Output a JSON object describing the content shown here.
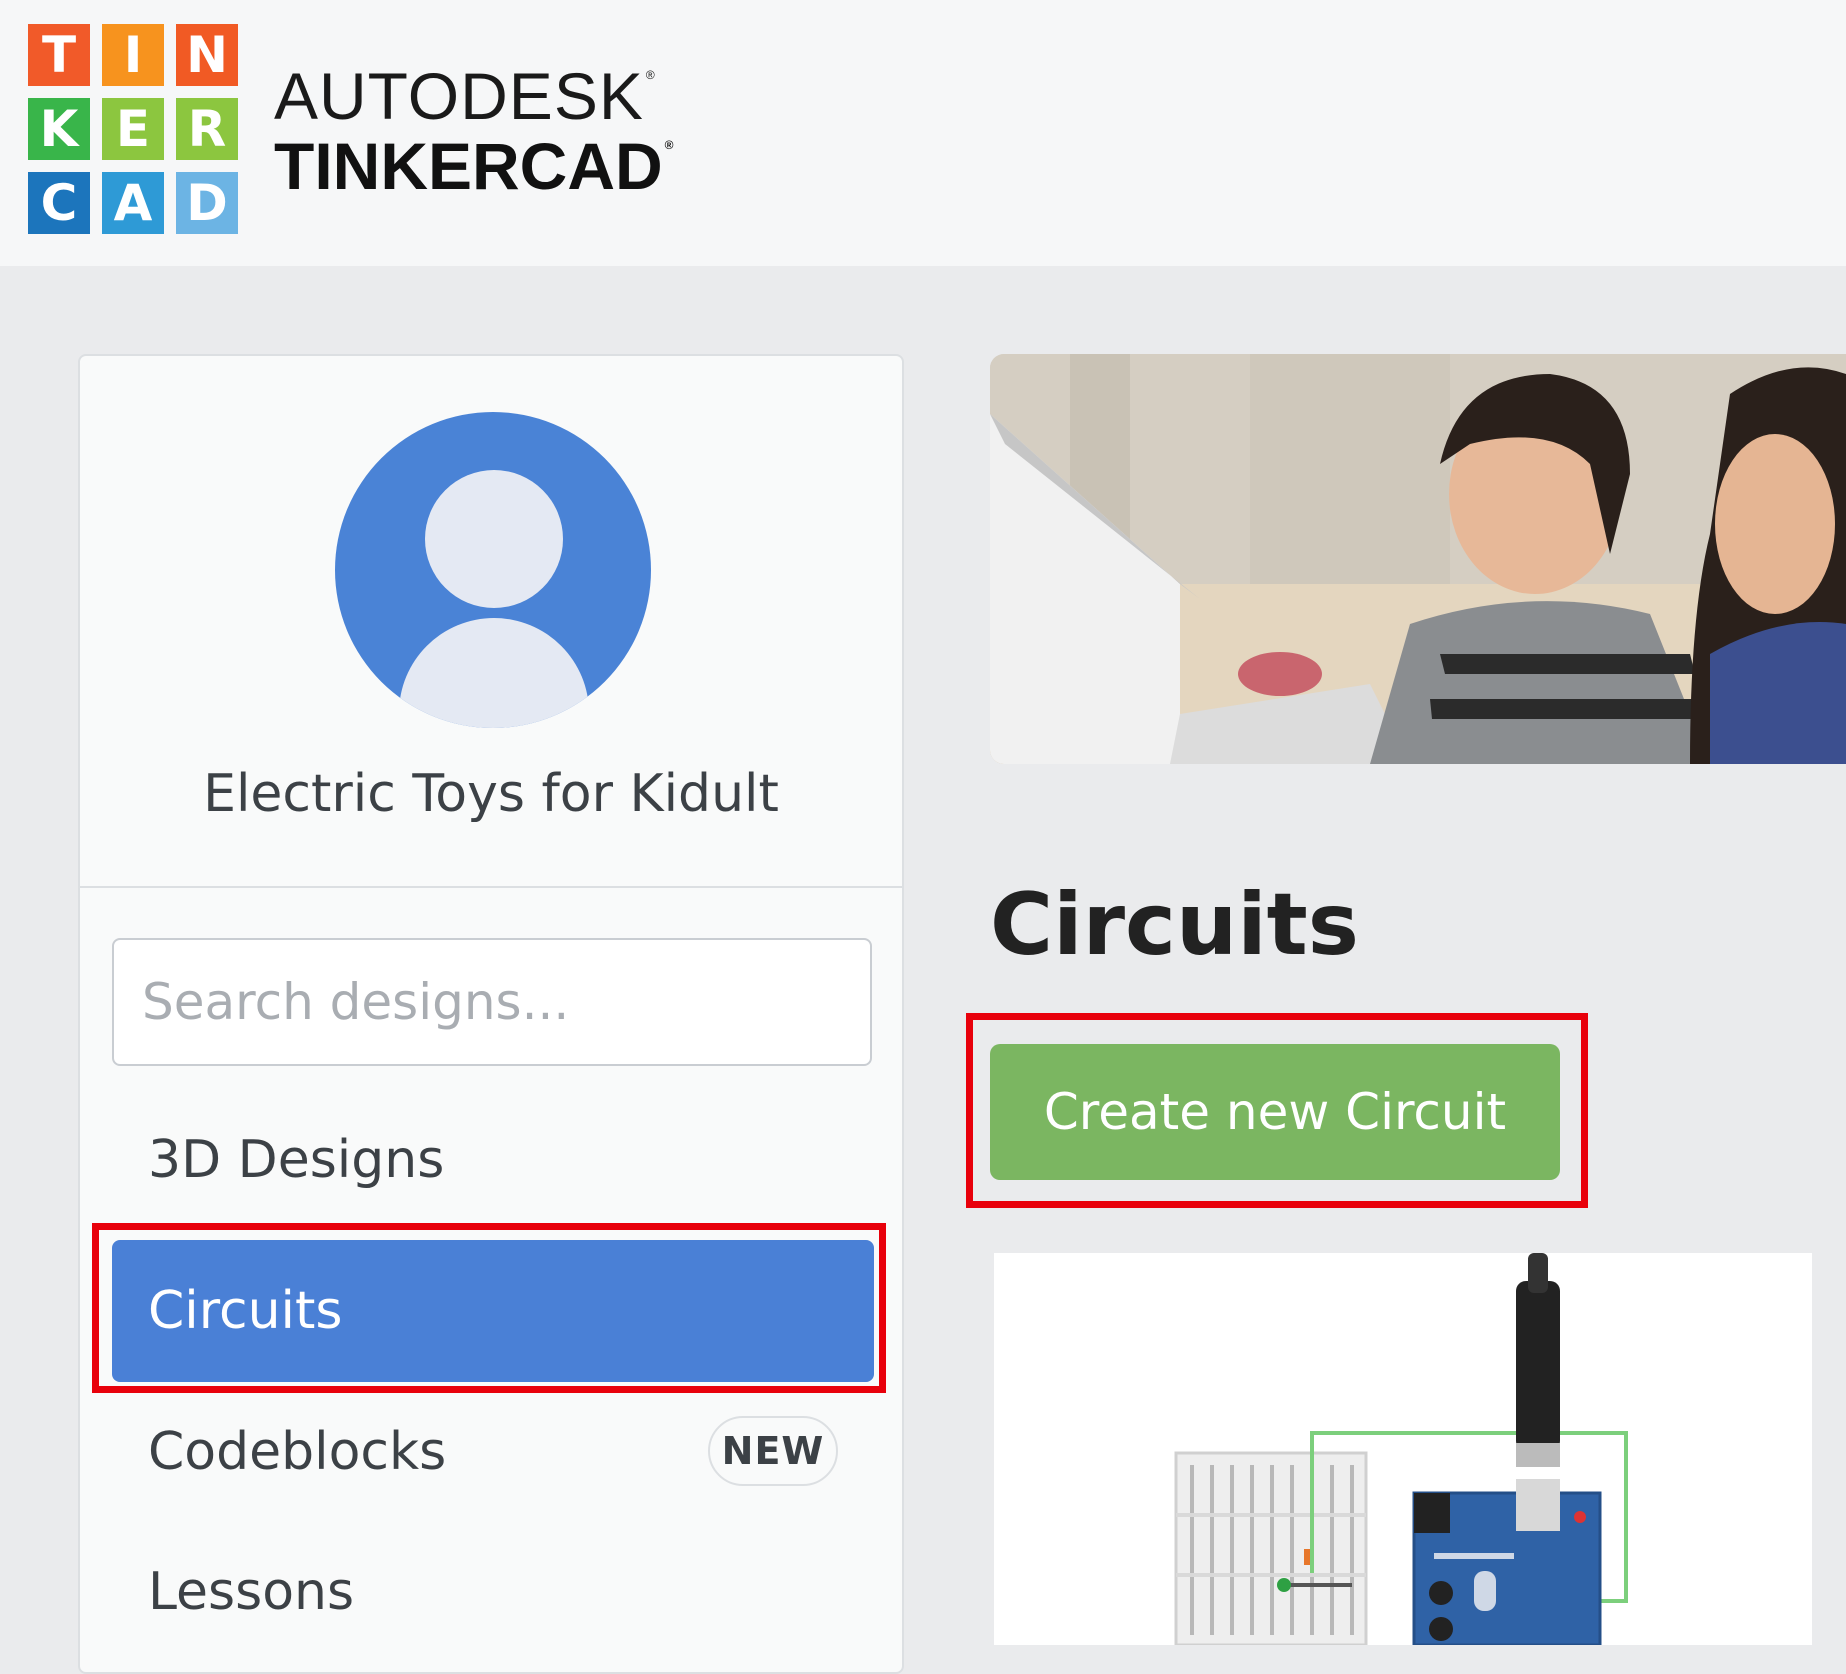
{
  "header": {
    "logo_letters": [
      "T",
      "I",
      "N",
      "K",
      "E",
      "R",
      "C",
      "A",
      "D"
    ],
    "logo_colors": [
      "#f05a24",
      "#f7931e",
      "#f15a24",
      "#39b54a",
      "#8cc63f",
      "#8cc63f",
      "#1c75bc",
      "#2e9ad6",
      "#6cb4e4"
    ],
    "brand_top": "AUTODESK",
    "brand_bottom": "TINKERCAD"
  },
  "profile": {
    "name": "Electric Toys for Kidult"
  },
  "search": {
    "placeholder": "Search designs..."
  },
  "nav": {
    "items": [
      {
        "label": "3D Designs"
      },
      {
        "label": "Circuits",
        "active": true
      },
      {
        "label": "Codeblocks",
        "badge": "NEW"
      },
      {
        "label": "Lessons"
      }
    ]
  },
  "main": {
    "title": "Circuits",
    "create_label": "Create new Circuit"
  },
  "colors": {
    "accent_blue": "#4a80d6",
    "create_green": "#7bb661",
    "highlight_red": "#e8000b"
  }
}
